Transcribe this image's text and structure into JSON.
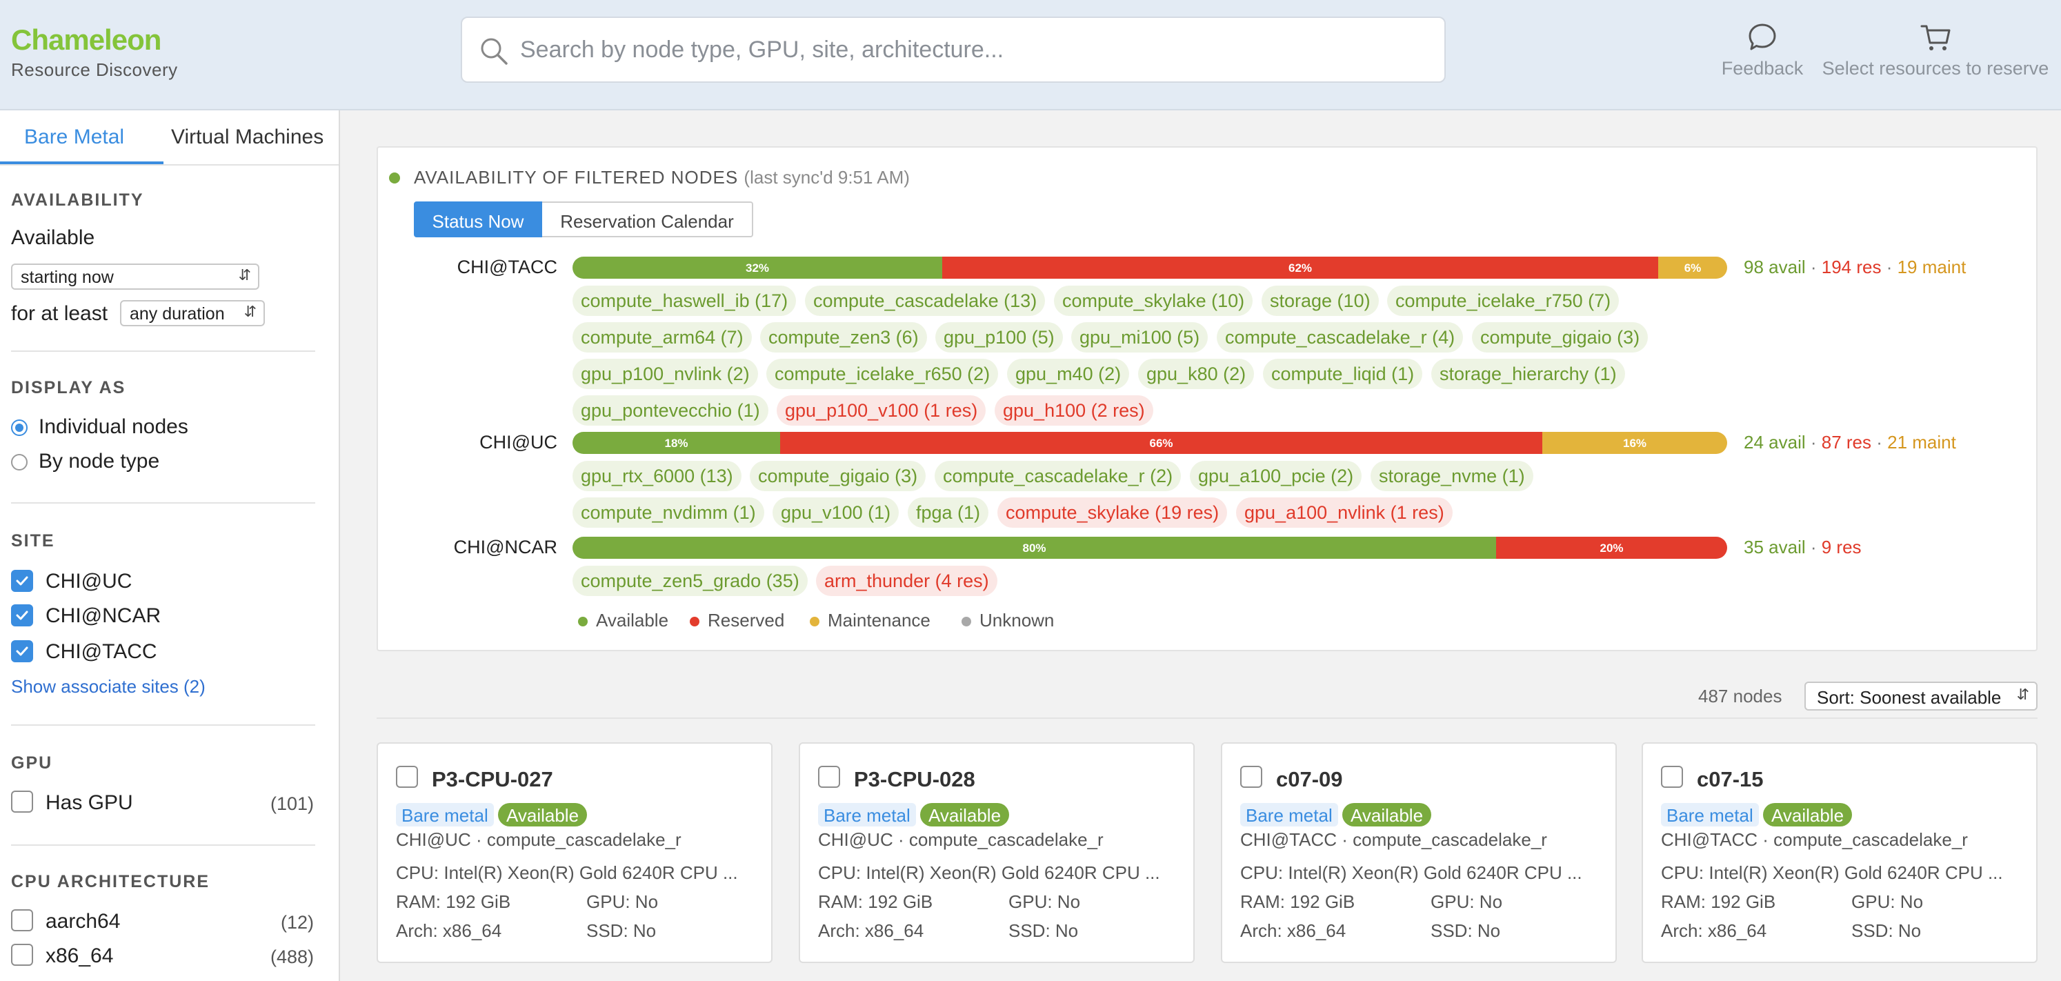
{
  "header": {
    "brand": "Chameleon",
    "subtitle": "Resource Discovery",
    "search_placeholder": "Search by node type, GPU, site, architecture...",
    "feedback_label": "Feedback",
    "reserve_label": "Select resources to reserve"
  },
  "sidebar": {
    "tabs": [
      "Bare Metal",
      "Virtual Machines"
    ],
    "availability": {
      "title": "AVAILABILITY",
      "available_label": "Available",
      "start_value": "starting now",
      "for_at_least_label": "for at least",
      "duration_value": "any duration"
    },
    "display_as": {
      "title": "DISPLAY AS",
      "options": [
        "Individual nodes",
        "By node type"
      ],
      "selected": "Individual nodes"
    },
    "site": {
      "title": "SITE",
      "options": [
        "CHI@UC",
        "CHI@NCAR",
        "CHI@TACC"
      ],
      "show_associate": "Show associate sites (2)"
    },
    "gpu": {
      "title": "GPU",
      "option": "Has GPU",
      "count": "(101)"
    },
    "cpu_arch": {
      "title": "CPU ARCHITECTURE",
      "options": [
        {
          "label": "aarch64",
          "count": "(12)"
        },
        {
          "label": "x86_64",
          "count": "(488)"
        }
      ]
    }
  },
  "availability_panel": {
    "title": "AVAILABILITY OF FILTERED NODES",
    "sync": "(last sync'd 9:51 AM)",
    "toggle": [
      "Status Now",
      "Reservation Calendar"
    ],
    "colors": {
      "available": "#7aab3e",
      "reserved": "#e33c2c",
      "maintenance": "#e3b43b",
      "unknown": "#a8a8a8"
    },
    "sites": [
      {
        "name": "CHI@TACC",
        "segments": [
          {
            "status": "av",
            "pct": 32,
            "label": "32%"
          },
          {
            "status": "rs",
            "pct": 62,
            "label": "62%"
          },
          {
            "status": "mt",
            "pct": 6,
            "label": "6%"
          }
        ],
        "avail": "98 avail",
        "res": "194 res",
        "maint": "19 maint",
        "chips": [
          {
            "t": "compute_haswell_ib (17)",
            "s": "av"
          },
          {
            "t": "compute_cascadelake (13)",
            "s": "av"
          },
          {
            "t": "compute_skylake (10)",
            "s": "av"
          },
          {
            "t": "storage (10)",
            "s": "av"
          },
          {
            "t": "compute_icelake_r750 (7)",
            "s": "av"
          },
          {
            "t": "compute_arm64 (7)",
            "s": "av"
          },
          {
            "t": "compute_zen3 (6)",
            "s": "av"
          },
          {
            "t": "gpu_p100 (5)",
            "s": "av"
          },
          {
            "t": "gpu_mi100 (5)",
            "s": "av"
          },
          {
            "t": "compute_cascadelake_r (4)",
            "s": "av"
          },
          {
            "t": "compute_gigaio (3)",
            "s": "av"
          },
          {
            "t": "gpu_p100_nvlink (2)",
            "s": "av"
          },
          {
            "t": "compute_icelake_r650 (2)",
            "s": "av"
          },
          {
            "t": "gpu_m40 (2)",
            "s": "av"
          },
          {
            "t": "gpu_k80 (2)",
            "s": "av"
          },
          {
            "t": "compute_liqid (1)",
            "s": "av"
          },
          {
            "t": "storage_hierarchy (1)",
            "s": "av"
          },
          {
            "t": "gpu_pontevecchio (1)",
            "s": "av"
          },
          {
            "t": "gpu_p100_v100 (1 res)",
            "s": "rs"
          },
          {
            "t": "gpu_h100 (2 res)",
            "s": "rs"
          }
        ]
      },
      {
        "name": "CHI@UC",
        "segments": [
          {
            "status": "av",
            "pct": 18,
            "label": "18%"
          },
          {
            "status": "rs",
            "pct": 66,
            "label": "66%"
          },
          {
            "status": "mt",
            "pct": 16,
            "label": "16%"
          }
        ],
        "avail": "24 avail",
        "res": "87 res",
        "maint": "21 maint",
        "chips": [
          {
            "t": "gpu_rtx_6000 (13)",
            "s": "av"
          },
          {
            "t": "compute_gigaio (3)",
            "s": "av"
          },
          {
            "t": "compute_cascadelake_r (2)",
            "s": "av"
          },
          {
            "t": "gpu_a100_pcie (2)",
            "s": "av"
          },
          {
            "t": "storage_nvme (1)",
            "s": "av"
          },
          {
            "t": "compute_nvdimm (1)",
            "s": "av"
          },
          {
            "t": "gpu_v100 (1)",
            "s": "av"
          },
          {
            "t": "fpga (1)",
            "s": "av"
          },
          {
            "t": "compute_skylake (19 res)",
            "s": "rs"
          },
          {
            "t": "gpu_a100_nvlink (1 res)",
            "s": "rs"
          }
        ]
      },
      {
        "name": "CHI@NCAR",
        "segments": [
          {
            "status": "av",
            "pct": 80,
            "label": "80%"
          },
          {
            "status": "rs",
            "pct": 20,
            "label": "20%"
          }
        ],
        "avail": "35 avail",
        "res": "9 res",
        "maint": "",
        "chips": [
          {
            "t": "compute_zen5_grado (35)",
            "s": "av"
          },
          {
            "t": "arm_thunder (4 res)",
            "s": "rs"
          }
        ]
      }
    ],
    "legend": [
      "Available",
      "Reserved",
      "Maintenance",
      "Unknown"
    ]
  },
  "results": {
    "count": "487 nodes",
    "sort": "Sort: Soonest available"
  },
  "cards": [
    {
      "name": "P3-CPU-027",
      "type_badge": "Bare metal",
      "status": "Available",
      "loc": "CHI@UC · compute_cascadelake_r",
      "cpu": "CPU: Intel(R) Xeon(R) Gold 6240R CPU ...",
      "ram": "RAM: 192 GiB",
      "gpu": "GPU: No",
      "arch": "Arch: x86_64",
      "ssd": "SSD: No"
    },
    {
      "name": "P3-CPU-028",
      "type_badge": "Bare metal",
      "status": "Available",
      "loc": "CHI@UC · compute_cascadelake_r",
      "cpu": "CPU: Intel(R) Xeon(R) Gold 6240R CPU ...",
      "ram": "RAM: 192 GiB",
      "gpu": "GPU: No",
      "arch": "Arch: x86_64",
      "ssd": "SSD: No"
    },
    {
      "name": "c07-09",
      "type_badge": "Bare metal",
      "status": "Available",
      "loc": "CHI@TACC · compute_cascadelake_r",
      "cpu": "CPU: Intel(R) Xeon(R) Gold 6240R CPU ...",
      "ram": "RAM: 192 GiB",
      "gpu": "GPU: No",
      "arch": "Arch: x86_64",
      "ssd": "SSD: No"
    },
    {
      "name": "c07-15",
      "type_badge": "Bare metal",
      "status": "Available",
      "loc": "CHI@TACC · compute_cascadelake_r",
      "cpu": "CPU: Intel(R) Xeon(R) Gold 6240R CPU ...",
      "ram": "RAM: 192 GiB",
      "gpu": "GPU: No",
      "arch": "Arch: x86_64",
      "ssd": "SSD: No"
    }
  ]
}
